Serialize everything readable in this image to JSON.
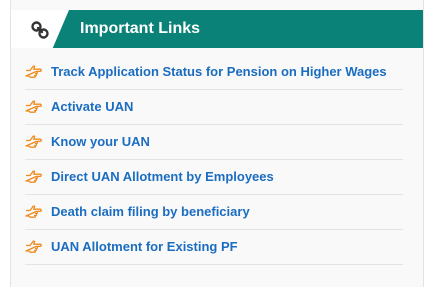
{
  "colors": {
    "header_bg": "#0a8278",
    "link_text": "#1b6dc1",
    "bullet_icon": "#f08a1c"
  },
  "header": {
    "icon": "link-icon",
    "title": "Important Links"
  },
  "links": {
    "bullet_icon": "hand-pointing-right-icon",
    "items": [
      {
        "label": "Track Application Status for Pension on Higher Wages"
      },
      {
        "label": "Activate UAN"
      },
      {
        "label": "Know your UAN"
      },
      {
        "label": "Direct UAN Allotment by Employees"
      },
      {
        "label": "Death claim filing by beneficiary"
      },
      {
        "label": "UAN Allotment for Existing PF"
      }
    ]
  }
}
